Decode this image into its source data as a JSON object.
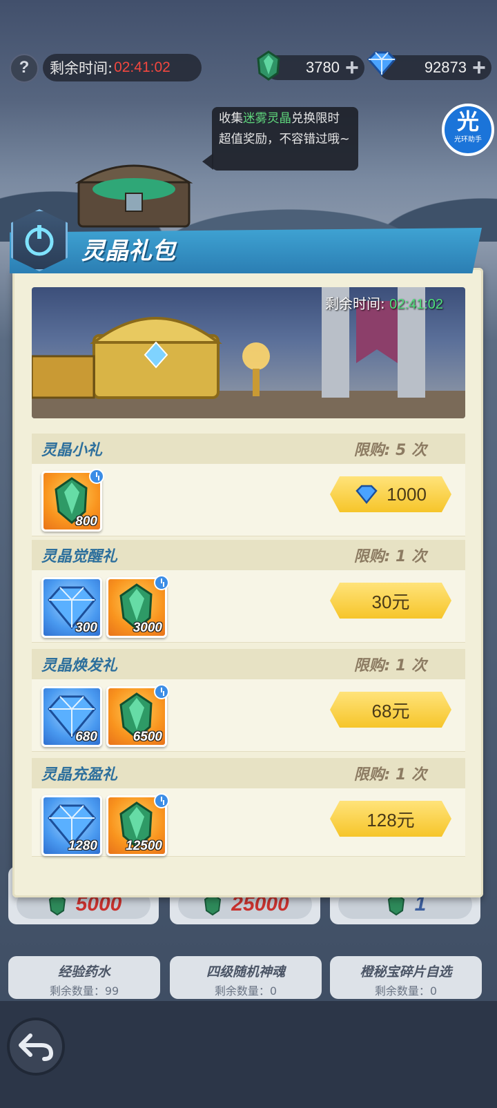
{
  "hud": {
    "help_label": "?",
    "timer_label": "剩余时间:",
    "timer_value": "02:41:02",
    "crystal_amount": "3780",
    "diamond_amount": "92873",
    "plus_label": "+"
  },
  "tooltip": {
    "prefix": "收集",
    "highlight": "迷雾灵晶",
    "suffix": "兑换限时超值奖励，不容错过哦~"
  },
  "assistant": {
    "glyph": "光",
    "label": "光环助手"
  },
  "panel": {
    "title": "灵晶礼包",
    "hero_timer_label": "剩余时间:",
    "hero_timer_value": "02:41:02"
  },
  "offers": [
    {
      "name": "灵晶小礼",
      "limit": "限购: 5 次",
      "items": [
        {
          "type": "crystal",
          "qty": "800"
        }
      ],
      "price": "1000",
      "price_icon": "diamond-icon"
    },
    {
      "name": "灵晶觉醒礼",
      "limit": "限购: 1 次",
      "items": [
        {
          "type": "diamond",
          "qty": "300"
        },
        {
          "type": "crystal",
          "qty": "3000"
        }
      ],
      "price": "30元"
    },
    {
      "name": "灵晶焕发礼",
      "limit": "限购: 1 次",
      "items": [
        {
          "type": "diamond",
          "qty": "680"
        },
        {
          "type": "crystal",
          "qty": "6500"
        }
      ],
      "price": "68元"
    },
    {
      "name": "灵晶充盈礼",
      "limit": "限购: 1 次",
      "items": [
        {
          "type": "diamond",
          "qty": "1280"
        },
        {
          "type": "crystal",
          "qty": "12500"
        }
      ],
      "price": "128元"
    }
  ],
  "background_shop": {
    "prices": [
      "5000",
      "25000",
      "1"
    ],
    "items": [
      {
        "title": "经验药水",
        "remaining": "剩余数量：99"
      },
      {
        "title": "四级随机神魂",
        "remaining": "剩余数量：0"
      },
      {
        "title": "橙秘宝碎片自选",
        "remaining": "剩余数量：0"
      }
    ]
  },
  "colors": {
    "timer_red": "#f2473f",
    "timer_green": "#4ee07a",
    "title_blue": "#2d6f9c",
    "price_gold": "#f6c52a",
    "bg_price_red": "#c8322e",
    "bg_price_blue": "#3d5f9e"
  }
}
